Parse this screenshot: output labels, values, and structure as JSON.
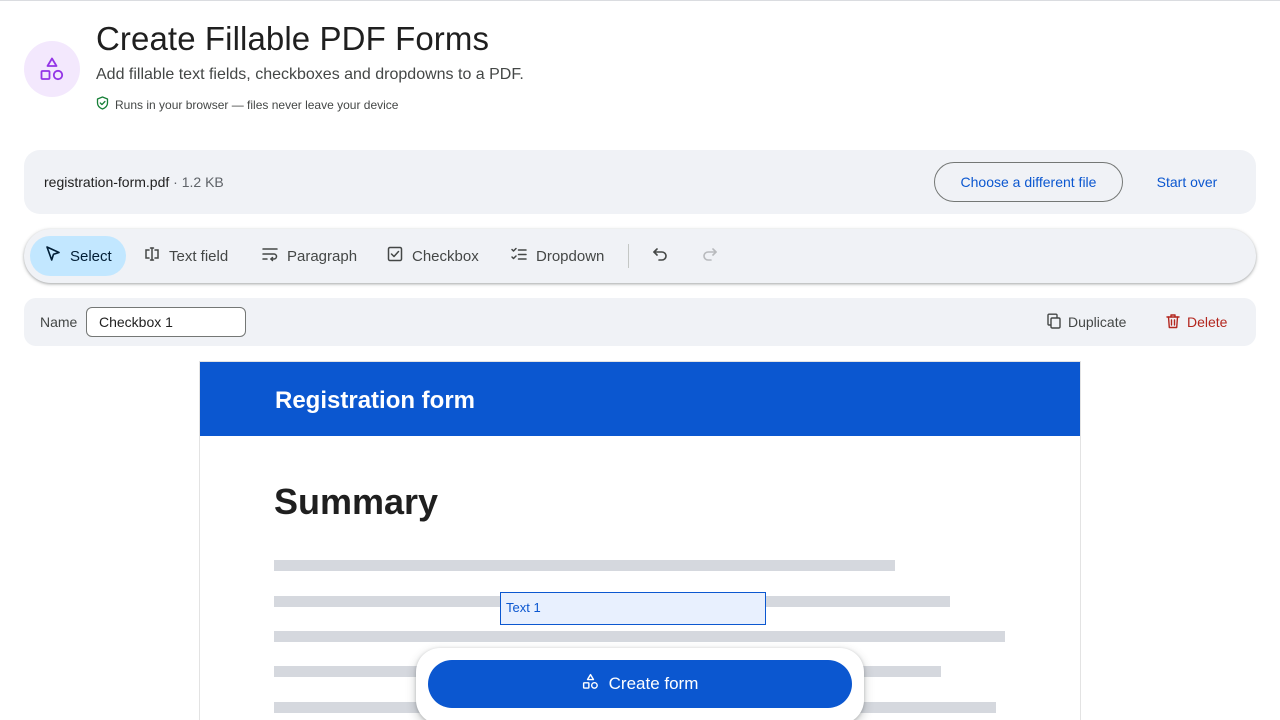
{
  "header": {
    "title": "Create Fillable PDF Forms",
    "subtitle": "Add fillable text fields, checkboxes and dropdowns to a PDF.",
    "privacy_note": "Runs in your browser — files never leave your device",
    "icon": "shapes-icon"
  },
  "file": {
    "name": "registration-form.pdf",
    "size": " · 1.2 KB",
    "choose_label": "Choose a different file",
    "start_over_label": "Start over"
  },
  "toolbar": {
    "tools": [
      {
        "label": "Select",
        "icon": "cursor-icon",
        "active": true
      },
      {
        "label": "Text field",
        "icon": "text-field-icon",
        "active": false
      },
      {
        "label": "Paragraph",
        "icon": "paragraph-icon",
        "active": false
      },
      {
        "label": "Checkbox",
        "icon": "checkbox-icon",
        "active": false
      },
      {
        "label": "Dropdown",
        "icon": "dropdown-list-icon",
        "active": false
      }
    ],
    "undo_icon": "undo-icon",
    "redo_icon": "redo-icon"
  },
  "properties": {
    "name_label": "Name",
    "name_value": "Checkbox 1",
    "duplicate_label": "Duplicate",
    "delete_label": "Delete"
  },
  "document": {
    "header_title": "Registration form",
    "heading": "Summary",
    "fields": [
      {
        "label": "Text 1"
      }
    ]
  },
  "action": {
    "create_label": "Create form"
  },
  "colors": {
    "accent": "#0b57d0",
    "active_tool_bg": "#c2e7ff",
    "danger": "#b3261e",
    "icon_bg": "#f3e8fd"
  }
}
